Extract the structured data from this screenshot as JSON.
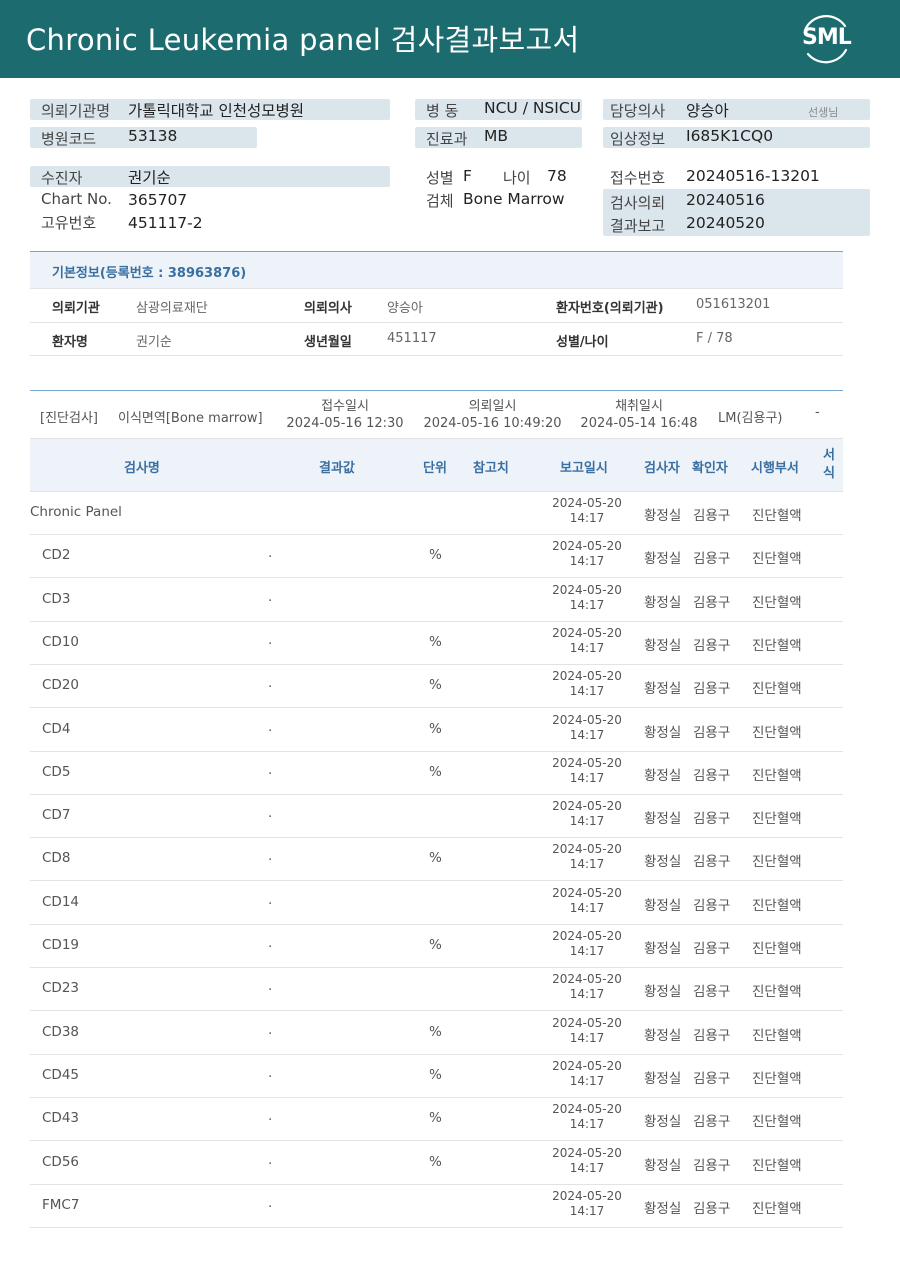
{
  "header": {
    "title": "Chronic  Leukemia  panel 검사결과보고서",
    "logo_text": "SML",
    "bg": "#1b6b6f"
  },
  "info": {
    "hospital_label": "의뢰기관명",
    "hospital_value": "가톨릭대학교 인천성모병원",
    "hospital_code_label": "병원코드",
    "hospital_code_value": "53138",
    "ward_label": "병  동",
    "ward_value": "NCU / NSICU",
    "dept_label": "진료과",
    "dept_value": "MB",
    "doctor_label": "담당의사",
    "doctor_value": "양승아",
    "doctor_suffix": "선생님",
    "clinical_label": "임상정보",
    "clinical_value": "I685K1CQ0",
    "patient_label": "수진자",
    "patient_value": "권기순",
    "chart_label": "Chart No.",
    "chart_value": "365707",
    "unique_label": "고유번호",
    "unique_value": "451117-2",
    "sex_label": "성별",
    "sex_value": "F",
    "age_label": "나이",
    "age_value": "78",
    "specimen_label": "검체",
    "specimen_value": "Bone Marrow",
    "receipt_label": "접수번호",
    "receipt_value": "20240516-13201",
    "request_label": "검사의뢰",
    "request_value": "20240516",
    "report_label": "결과보고",
    "report_value": "20240520"
  },
  "basic": {
    "title": "기본정보(등록번호 : 38963876)",
    "inst_label": "의뢰기관",
    "inst_value": "삼광의료재단",
    "doc_label": "의뢰의사",
    "doc_value": "양승아",
    "pid_label": "환자번호(의뢰기관)",
    "pid_value": "051613201",
    "name_label": "환자명",
    "name_value": "권기순",
    "dob_label": "생년월일",
    "dob_value": "451117",
    "sexage_label": "성별/나이",
    "sexage_value": "F / 78"
  },
  "exam": {
    "category": "[진단검사]",
    "item": "이식면역[Bone marrow]",
    "receipt_label": "접수일시",
    "receipt_value": "2024-05-16 12:30",
    "request_label": "의뢰일시",
    "request_value": "2024-05-16 10:49:20",
    "collect_label": "채취일시",
    "collect_value": "2024-05-14 16:48",
    "lm": "LM(김용구)",
    "dash": "-"
  },
  "columns": {
    "name": "검사명",
    "result": "결과값",
    "unit": "단위",
    "ref": "참고치",
    "date": "보고일시",
    "tester": "검사자",
    "confirmer": "확인자",
    "dept": "시행부서",
    "form": "서\n식"
  },
  "rows": [
    {
      "name": "Chronic Panel",
      "result": "",
      "unit": "",
      "date": "2024-05-20",
      "time": "14:17",
      "tester": "황정실",
      "confirmer": "김용구",
      "dept": "진단혈액"
    },
    {
      "name": "CD2",
      "result": ".",
      "unit": "%",
      "date": "2024-05-20",
      "time": "14:17",
      "tester": "황정실",
      "confirmer": "김용구",
      "dept": "진단혈액"
    },
    {
      "name": "CD3",
      "result": ".",
      "unit": "",
      "date": "2024-05-20",
      "time": "14:17",
      "tester": "황정실",
      "confirmer": "김용구",
      "dept": "진단혈액"
    },
    {
      "name": "CD10",
      "result": ".",
      "unit": "%",
      "date": "2024-05-20",
      "time": "14:17",
      "tester": "황정실",
      "confirmer": "김용구",
      "dept": "진단혈액"
    },
    {
      "name": "CD20",
      "result": ".",
      "unit": "%",
      "date": "2024-05-20",
      "time": "14:17",
      "tester": "황정실",
      "confirmer": "김용구",
      "dept": "진단혈액"
    },
    {
      "name": "CD4",
      "result": ".",
      "unit": "%",
      "date": "2024-05-20",
      "time": "14:17",
      "tester": "황정실",
      "confirmer": "김용구",
      "dept": "진단혈액"
    },
    {
      "name": "CD5",
      "result": ".",
      "unit": "%",
      "date": "2024-05-20",
      "time": "14:17",
      "tester": "황정실",
      "confirmer": "김용구",
      "dept": "진단혈액"
    },
    {
      "name": "CD7",
      "result": ".",
      "unit": "",
      "date": "2024-05-20",
      "time": "14:17",
      "tester": "황정실",
      "confirmer": "김용구",
      "dept": "진단혈액"
    },
    {
      "name": "CD8",
      "result": ".",
      "unit": "%",
      "date": "2024-05-20",
      "time": "14:17",
      "tester": "황정실",
      "confirmer": "김용구",
      "dept": "진단혈액"
    },
    {
      "name": "CD14",
      "result": ".",
      "unit": "",
      "date": "2024-05-20",
      "time": "14:17",
      "tester": "황정실",
      "confirmer": "김용구",
      "dept": "진단혈액"
    },
    {
      "name": "CD19",
      "result": ".",
      "unit": "%",
      "date": "2024-05-20",
      "time": "14:17",
      "tester": "황정실",
      "confirmer": "김용구",
      "dept": "진단혈액"
    },
    {
      "name": "CD23",
      "result": ".",
      "unit": "",
      "date": "2024-05-20",
      "time": "14:17",
      "tester": "황정실",
      "confirmer": "김용구",
      "dept": "진단혈액"
    },
    {
      "name": "CD38",
      "result": ".",
      "unit": "%",
      "date": "2024-05-20",
      "time": "14:17",
      "tester": "황정실",
      "confirmer": "김용구",
      "dept": "진단혈액"
    },
    {
      "name": "CD45",
      "result": ".",
      "unit": "%",
      "date": "2024-05-20",
      "time": "14:17",
      "tester": "황정실",
      "confirmer": "김용구",
      "dept": "진단혈액"
    },
    {
      "name": "CD43",
      "result": ".",
      "unit": "%",
      "date": "2024-05-20",
      "time": "14:17",
      "tester": "황정실",
      "confirmer": "김용구",
      "dept": "진단혈액"
    },
    {
      "name": "CD56",
      "result": ".",
      "unit": "%",
      "date": "2024-05-20",
      "time": "14:17",
      "tester": "황정실",
      "confirmer": "김용구",
      "dept": "진단혈액"
    },
    {
      "name": "FMC7",
      "result": ".",
      "unit": "",
      "date": "2024-05-20",
      "time": "14:17",
      "tester": "황정실",
      "confirmer": "김용구",
      "dept": "진단혈액"
    }
  ]
}
